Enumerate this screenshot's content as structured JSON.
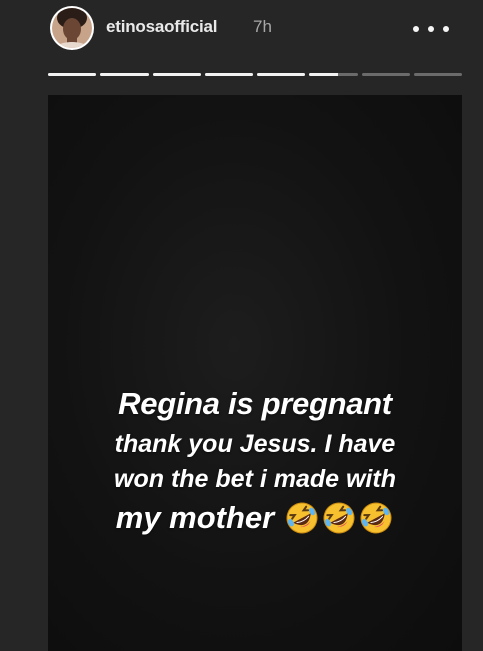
{
  "story": {
    "username": "etinosaofficial",
    "timestamp": "7h",
    "segments": [
      {
        "progress": 1
      },
      {
        "progress": 1
      },
      {
        "progress": 1
      },
      {
        "progress": 1
      },
      {
        "progress": 1
      },
      {
        "progress": 0.6
      },
      {
        "progress": 0
      },
      {
        "progress": 0
      }
    ],
    "caption": {
      "line1": "Regina is pregnant",
      "line2": "thank you Jesus. I have",
      "line3": "won the bet i made with",
      "line4": "my mother"
    },
    "emojis": [
      "rolling-on-floor-laughing",
      "rolling-on-floor-laughing",
      "rolling-on-floor-laughing"
    ]
  },
  "colors": {
    "background": "#262626",
    "progress_filled": "#f2f2f2",
    "progress_empty": "#6b6b6b",
    "emoji_face": "#f7c02f"
  }
}
